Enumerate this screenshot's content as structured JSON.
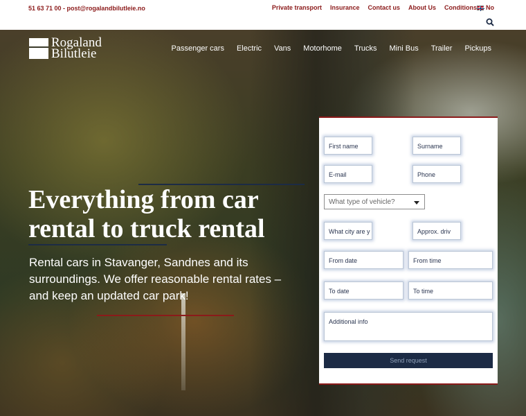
{
  "topbar": {
    "contact": "51 63 71 00 - post@rogalandbilutleie.no",
    "links": [
      "Private transport",
      "Insurance",
      "Contact us",
      "About Us",
      "Conditions"
    ],
    "language": "No"
  },
  "logo": {
    "line1": "Rogaland",
    "line2": "Bilutleie"
  },
  "mainnav": [
    "Passenger cars",
    "Electric",
    "Vans",
    "Motorhome",
    "Trucks",
    "Mini Bus",
    "Trailer",
    "Pickups"
  ],
  "hero": {
    "headline": "Everything from car rental to truck rental",
    "lead": "Rental cars in Stavanger, Sandnes and its surroundings. We offer reasonable rental rates – and keep an updated car park!"
  },
  "form": {
    "first_name": "First name",
    "surname": "Surname",
    "email": "E-mail",
    "phone": "Phone",
    "vehicle_select": "What type of vehicle?",
    "city": "What city are y",
    "approx": "Approx. driv",
    "from_date": "From date",
    "from_time": "From time",
    "to_date": "To date",
    "to_time": "To time",
    "additional_info": "Additional info",
    "submit": "Send request"
  },
  "colors": {
    "brand_red": "#8b1a1a",
    "navy": "#1c2b45",
    "white": "#ffffff"
  },
  "icons": {
    "search": "search-icon",
    "flag": "norway-flag-icon"
  }
}
